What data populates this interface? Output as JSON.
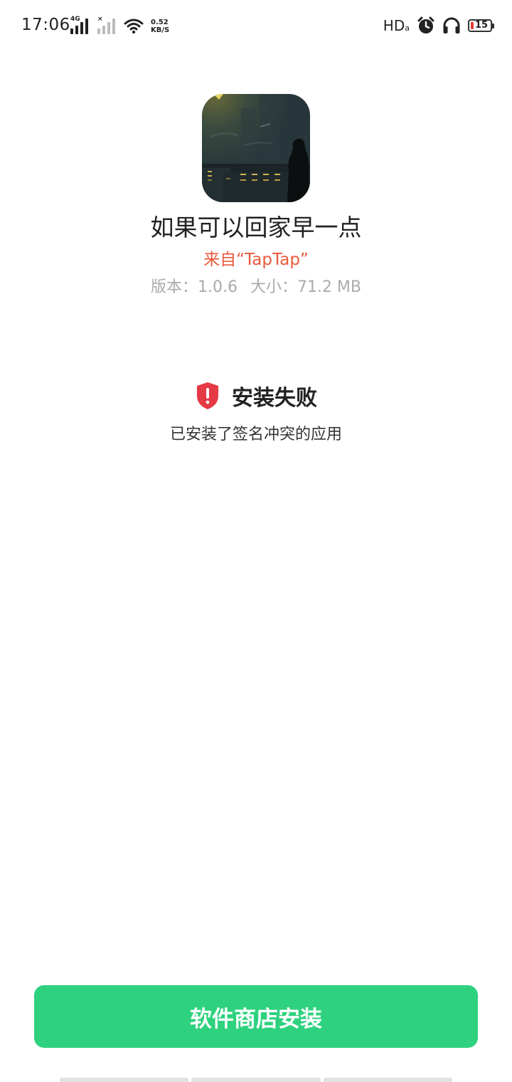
{
  "status_bar": {
    "time": "17:06",
    "sim1_tag": "4G",
    "sim2_tag": "×",
    "net_speed_value": "0.52",
    "net_speed_unit": "KB/S",
    "hd_label": "HD",
    "hd_sub": "a",
    "battery_level": "15",
    "icons": [
      "signal-icon",
      "signal-icon",
      "wifi-icon",
      "alarm-clock-icon",
      "headphones-icon",
      "battery-icon"
    ]
  },
  "app": {
    "name": "如果可以回家早一点",
    "source": "来自“TapTap”",
    "version": "版本：1.0.6",
    "size": "大小：71.2 MB"
  },
  "result": {
    "title": "安装失败",
    "description": "已安装了签名冲突的应用",
    "icon": "shield-alert-icon",
    "icon_color": "#e53945"
  },
  "action": {
    "store_install_label": "软件商店安装",
    "button_color": "#2ed27e"
  }
}
